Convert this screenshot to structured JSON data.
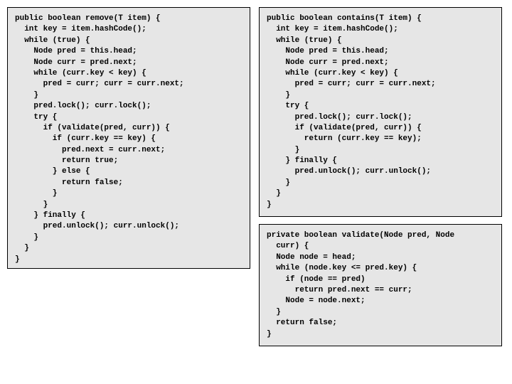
{
  "boxes": {
    "remove": "public boolean remove(T item) {\n  int key = item.hashCode();\n  while (true) {\n    Node pred = this.head;\n    Node curr = pred.next;\n    while (curr.key < key) {\n      pred = curr; curr = curr.next;\n    }\n    pred.lock(); curr.lock();\n    try {\n      if (validate(pred, curr)) {\n        if (curr.key == key) {\n          pred.next = curr.next;\n          return true;\n        } else {\n          return false;\n        }\n      }\n    } finally {\n      pred.unlock(); curr.unlock();\n    }\n  }\n}",
    "contains": "public boolean contains(T item) {\n  int key = item.hashCode();\n  while (true) {\n    Node pred = this.head;\n    Node curr = pred.next;\n    while (curr.key < key) {\n      pred = curr; curr = curr.next;\n    }\n    try {\n      pred.lock(); curr.lock();\n      if (validate(pred, curr)) {\n        return (curr.key == key);\n      }\n    } finally {\n      pred.unlock(); curr.unlock();\n    }\n  }\n}",
    "validate": "private boolean validate(Node pred, Node\n  curr) {\n  Node node = head;\n  while (node.key <= pred.key) {\n    if (node == pred)\n      return pred.next == curr;\n    Node = node.next;\n  }\n  return false;\n}"
  }
}
